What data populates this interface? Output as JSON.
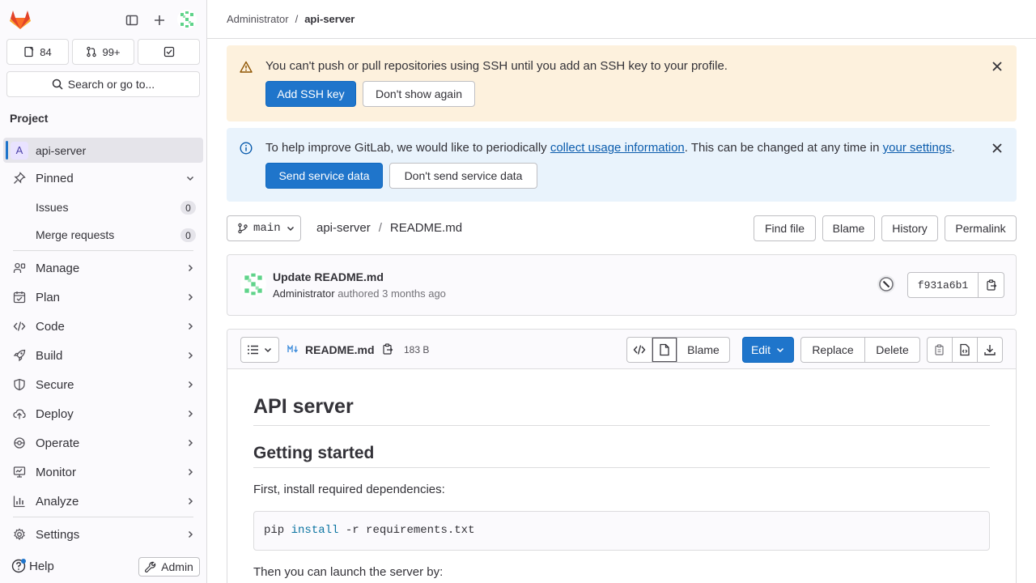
{
  "sidebar": {
    "issues_count": "84",
    "mr_count": "99+",
    "search_label": "Search or go to...",
    "section_title": "Project",
    "project": {
      "initial": "A",
      "name": "api-server"
    },
    "pinned_label": "Pinned",
    "pinned_items": [
      {
        "label": "Issues",
        "count": "0"
      },
      {
        "label": "Merge requests",
        "count": "0"
      }
    ],
    "nav": [
      {
        "label": "Manage",
        "icon": "users-icon"
      },
      {
        "label": "Plan",
        "icon": "calendar-icon"
      },
      {
        "label": "Code",
        "icon": "code-icon"
      },
      {
        "label": "Build",
        "icon": "rocket-icon"
      },
      {
        "label": "Secure",
        "icon": "shield-icon"
      },
      {
        "label": "Deploy",
        "icon": "cloud-upload-icon"
      },
      {
        "label": "Operate",
        "icon": "operate-icon"
      },
      {
        "label": "Monitor",
        "icon": "monitor-icon"
      },
      {
        "label": "Analyze",
        "icon": "chart-icon"
      }
    ],
    "settings_label": "Settings",
    "help_label": "Help",
    "admin_label": "Admin"
  },
  "breadcrumb": {
    "parent": "Administrator",
    "sep": "/",
    "current": "api-server"
  },
  "ssh_alert": {
    "text": "You can't push or pull repositories using SSH until you add an SSH key to your profile.",
    "primary": "Add SSH key",
    "secondary": "Don't show again"
  },
  "usage_alert": {
    "text_before": "To help improve GitLab, we would like to periodically ",
    "link1": "collect usage information",
    "text_middle": ". This can be changed at any time in ",
    "link2": "your settings",
    "text_after": ".",
    "primary": "Send service data",
    "secondary": "Don't send service data"
  },
  "repo": {
    "branch": "main",
    "path_root": "api-server",
    "path_sep": "/",
    "path_file": "README.md",
    "actions": [
      "Find file",
      "Blame",
      "History",
      "Permalink"
    ]
  },
  "commit": {
    "title": "Update README.md",
    "author": "Administrator",
    "meta": "authored 3 months ago",
    "sha": "f931a6b1"
  },
  "file": {
    "name": "README.md",
    "size": "183 B",
    "blame_label": "Blame",
    "edit_label": "Edit",
    "replace_label": "Replace",
    "delete_label": "Delete"
  },
  "readme": {
    "h1": "API server",
    "h2": "Getting started",
    "p1": "First, install required dependencies:",
    "code_cmd": "pip",
    "code_kw": "install",
    "code_rest": "-r requirements.txt",
    "p2": "Then you can launch the server by:"
  },
  "colors": {
    "accent": "#1f75cb",
    "warning_bg": "#fdf1dd",
    "info_bg": "#e9f3fc"
  }
}
